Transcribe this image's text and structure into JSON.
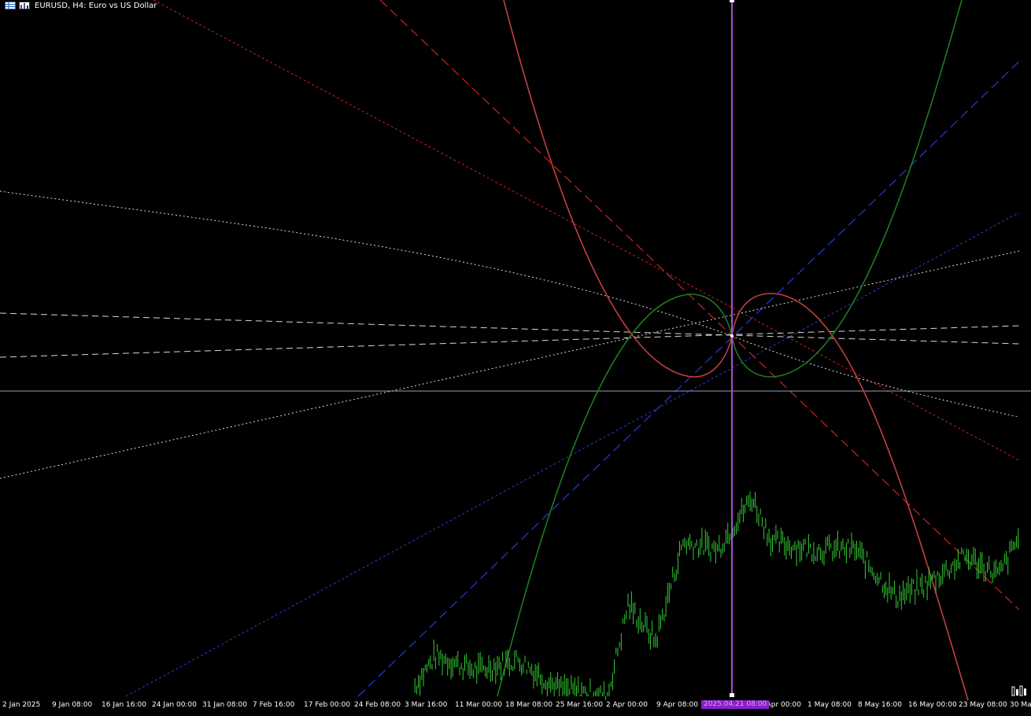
{
  "window": {
    "symbol_title": "EURUSD, H4:  Euro vs US Dollar"
  },
  "icons": {
    "title_icon_1": "chart-grid-icon",
    "title_icon_2": "chart-properties-icon",
    "corner_icon": "depth-of-market-icon"
  },
  "colors": {
    "background": "#000000",
    "candles": "#33cc33",
    "arc_red": "#c04040",
    "arc_green": "#1f7a1f",
    "ray_red": "#cc2222",
    "ray_blue": "#2233bb",
    "ray_white": "#d8d8d8",
    "horizontal_line": "#8fa0c0",
    "vertical_line": "#b24ad6",
    "cursor_label_bg": "#8a1fc7"
  },
  "x_axis": {
    "labels": [
      "2 Jan 2025",
      "9 Jan 08:00",
      "16 Jan 16:00",
      "24 Jan 00:00",
      "31 Jan 08:00",
      "7 Feb 16:00",
      "17 Feb 00:00",
      "24 Feb 08:00",
      "3 Mar 16:00",
      "11 Mar 00:00",
      "18 Mar 08:00",
      "25 Mar 16:00",
      "2 Apr 00:00",
      "9 Apr 08:00",
      "4 Apr 00:00",
      "1 May 08:00",
      "8 May 16:00",
      "16 May 00:00",
      "23 May 08:00",
      "30 Ma"
    ],
    "cursor_label": "2025.04.21 08:00"
  },
  "chart_data": {
    "type": "candlestick",
    "symbol": "EURUSD",
    "timeframe": "H4",
    "title": "EURUSD, H4:  Euro vs US Dollar",
    "x_tick_labels": [
      "2 Jan 2025",
      "9 Jan 08:00",
      "16 Jan 16:00",
      "24 Jan 00:00",
      "31 Jan 08:00",
      "7 Feb 16:00",
      "17 Feb 00:00",
      "24 Feb 08:00",
      "3 Mar 16:00",
      "11 Mar 00:00",
      "18 Mar 08:00",
      "25 Mar 16:00",
      "2 Apr 00:00",
      "9 Apr 08:00",
      "4 Apr 00:00",
      "1 May 08:00",
      "8 May 16:00",
      "16 May 00:00",
      "23 May 08:00",
      "30 Ma"
    ],
    "cursor_time": "2025.04.21 08:00",
    "grid": false,
    "legend": "none",
    "price_path_description_points": [
      {
        "date": "2025-03-03",
        "level": 0.03
      },
      {
        "date": "2025-03-06",
        "level": 0.11
      },
      {
        "date": "2025-03-12",
        "level": 0.07
      },
      {
        "date": "2025-03-18",
        "level": 0.1
      },
      {
        "date": "2025-03-24",
        "level": 0.02
      },
      {
        "date": "2025-03-31",
        "level": 0.0
      },
      {
        "date": "2025-04-03",
        "level": 0.25
      },
      {
        "date": "2025-04-07",
        "level": 0.15
      },
      {
        "date": "2025-04-11",
        "level": 0.42
      },
      {
        "date": "2025-04-16",
        "level": 0.4
      },
      {
        "date": "2025-04-21",
        "level": 0.54
      },
      {
        "date": "2025-04-24",
        "level": 0.42
      },
      {
        "date": "2025-04-30",
        "level": 0.4
      },
      {
        "date": "2025-05-06",
        "level": 0.4
      },
      {
        "date": "2025-05-12",
        "level": 0.27
      },
      {
        "date": "2025-05-16",
        "level": 0.3
      },
      {
        "date": "2025-05-22",
        "level": 0.38
      },
      {
        "date": "2025-05-27",
        "level": 0.33
      },
      {
        "date": "2025-05-30",
        "level": 0.44
      }
    ]
  }
}
